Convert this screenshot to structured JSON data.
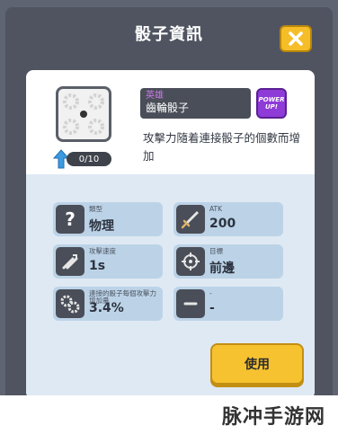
{
  "dialog": {
    "title": "骰子資訊",
    "close_icon": "close-icon"
  },
  "dice": {
    "icon": "gear-dice-icon",
    "level_icon": "upgrade-arrow-icon",
    "level": "0/10",
    "rarity": "英雄",
    "name": "齒輪骰子",
    "powerup_icon": "power-up-icon",
    "powerup_line1": "POWER",
    "powerup_line2": "UP!",
    "description": "攻擊力隨着連接骰子的個數而增加"
  },
  "stats": [
    {
      "icon": "question-icon",
      "label": "類型",
      "value": "物理"
    },
    {
      "icon": "sword-icon",
      "label": "ATK",
      "value": "200"
    },
    {
      "icon": "attack-speed-icon",
      "label": "攻擊速度",
      "value": "1s"
    },
    {
      "icon": "target-icon",
      "label": "目標",
      "value": "前邊"
    },
    {
      "icon": "gears-icon",
      "label": "連接的骰子每個攻擊力增加量",
      "value": "3.4%"
    },
    {
      "icon": "minus-icon",
      "label": "-",
      "value": "-"
    }
  ],
  "actions": {
    "use_label": "使用"
  },
  "watermark": {
    "text": "脉冲手游网"
  },
  "colors": {
    "accent_yellow": "#f6c230",
    "rarity_purple": "#c878e6",
    "powerup_purple": "#8e3bd7",
    "stat_bg": "#bcd3e7"
  }
}
